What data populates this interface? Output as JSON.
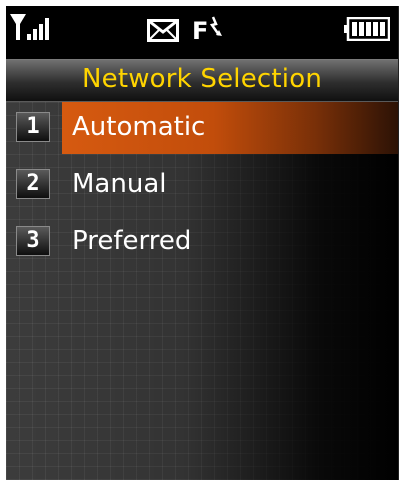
{
  "status_bar": {
    "signal_icon": "signal-strength-icon",
    "message_icon": "envelope-icon",
    "indicator_text": "F",
    "battery_icon": "battery-full-icon"
  },
  "title": "Network Selection",
  "menu": {
    "items": [
      {
        "number": "1",
        "label": "Automatic",
        "selected": true
      },
      {
        "number": "2",
        "label": "Manual",
        "selected": false
      },
      {
        "number": "3",
        "label": "Preferred",
        "selected": false
      }
    ]
  },
  "colors": {
    "title_text": "#ffd400",
    "highlight": "#d65a10",
    "background": "#000000"
  }
}
